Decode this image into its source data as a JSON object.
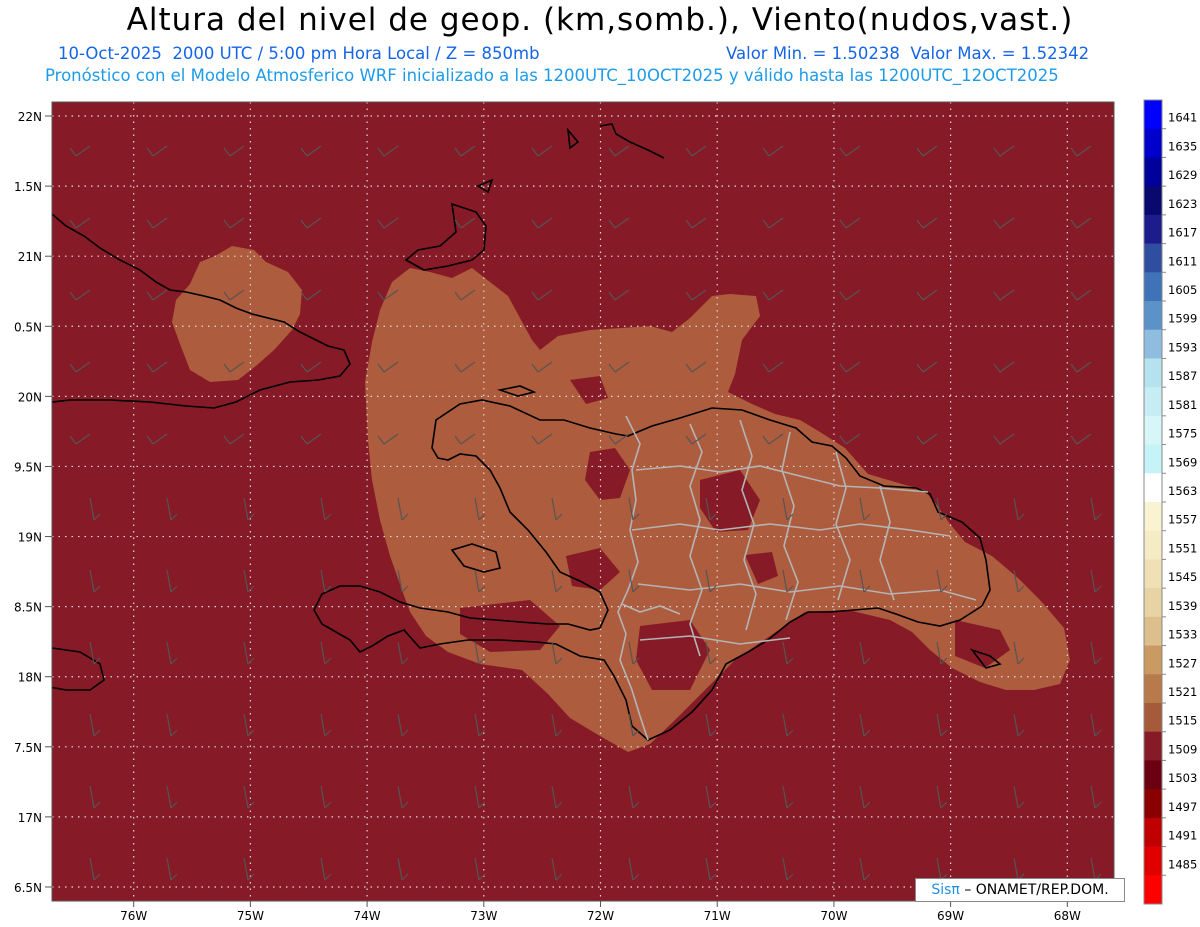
{
  "header": {
    "title": "Altura del nivel de geop. (km,somb.), Viento(nudos,vast.)",
    "line1_left": "10-Oct-2025  2000 UTC / 5:00 pm Hora Local / Z = 850mb",
    "line1_right": "Valor Min. = 1.50238  Valor Max. = 1.52342",
    "line2": "Pronóstico con el Modelo Atmosferico WRF inicializado a las 1200UTC_10OCT2025 y válido hasta las  1200UTC_12OCT2025"
  },
  "map": {
    "lon_range": [
      -76.7,
      -67.6
    ],
    "lat_range": [
      16.4,
      22.1
    ],
    "lat_ticks": [
      {
        "value": 22.0,
        "label": "22N"
      },
      {
        "value": 21.5,
        "label": "1.5N"
      },
      {
        "value": 21.0,
        "label": "21N"
      },
      {
        "value": 20.5,
        "label": "0.5N"
      },
      {
        "value": 20.0,
        "label": "20N"
      },
      {
        "value": 19.5,
        "label": "9.5N"
      },
      {
        "value": 19.0,
        "label": "19N"
      },
      {
        "value": 18.5,
        "label": "8.5N"
      },
      {
        "value": 18.0,
        "label": "18N"
      },
      {
        "value": 17.5,
        "label": "7.5N"
      },
      {
        "value": 17.0,
        "label": "17N"
      },
      {
        "value": 16.5,
        "label": "6.5N"
      }
    ],
    "lon_ticks": [
      {
        "value": -76,
        "label": "76W"
      },
      {
        "value": -75,
        "label": "75W"
      },
      {
        "value": -74,
        "label": "74W"
      },
      {
        "value": -73,
        "label": "73W"
      },
      {
        "value": -72,
        "label": "72W"
      },
      {
        "value": -71,
        "label": "71W"
      },
      {
        "value": -70,
        "label": "70W"
      },
      {
        "value": -69,
        "label": "69W"
      },
      {
        "value": -68,
        "label": "68W"
      }
    ],
    "background_color": "#861a27",
    "fill_color": "#ad5c3e",
    "light_fill_color": "#be7a4c",
    "grid": true
  },
  "colorbar": {
    "labels": [
      "1641",
      "1635",
      "1629",
      "1623",
      "1617",
      "1611",
      "1605",
      "1599",
      "1593",
      "1587",
      "1581",
      "1575",
      "1569",
      "1563",
      "1557",
      "1551",
      "1545",
      "1539",
      "1533",
      "1527",
      "1521",
      "1515",
      "1509",
      "1503",
      "1497",
      "1491",
      "1485"
    ],
    "colors": [
      "#0000ff",
      "#0000cc",
      "#00009a",
      "#08086e",
      "#1c1c8c",
      "#2f4ea0",
      "#3f72b6",
      "#5b92c8",
      "#8fbde0",
      "#b6e2ef",
      "#c6edf3",
      "#d6f6f8",
      "#c6f3f8",
      "#ffffff",
      "#faf3d2",
      "#f5ecc6",
      "#f0e0b6",
      "#e8d3a4",
      "#dcbf8c",
      "#c99a62",
      "#b8794b",
      "#a55a3a",
      "#861a27",
      "#6a0012",
      "#8a0000",
      "#c00000",
      "#e00000",
      "#ff0000"
    ]
  },
  "credit": {
    "sis": "Sisπ",
    "org": "– ONAMET/REP.DOM."
  }
}
